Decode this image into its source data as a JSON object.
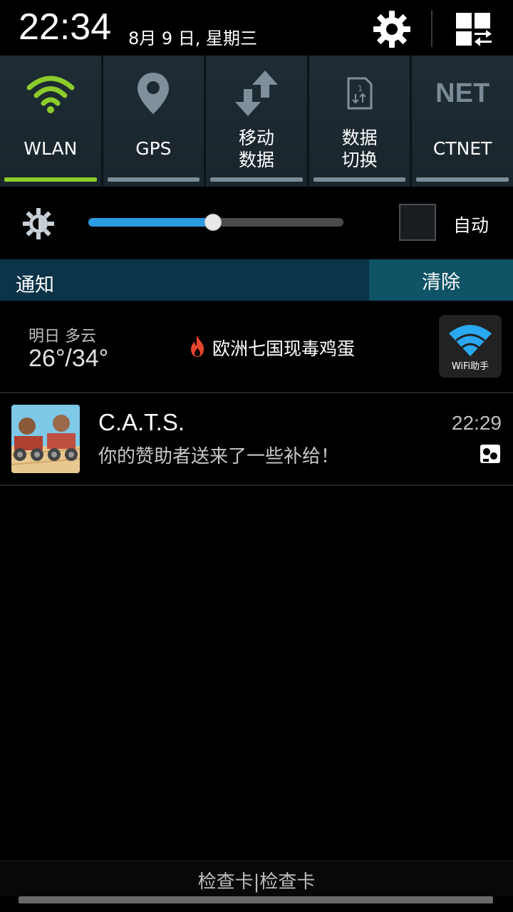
{
  "status": {
    "clock": "22:34",
    "date": "8月 9 日, 星期三"
  },
  "header": {
    "settings_icon": "gear-icon",
    "edit_icon": "grid-toggle-icon"
  },
  "toggles": [
    {
      "label": "WLAN",
      "icon": "wifi-icon",
      "active": true
    },
    {
      "label": "GPS",
      "icon": "location-pin-icon",
      "active": false
    },
    {
      "label": "移动\n数据",
      "icon": "data-arrows-icon",
      "active": false
    },
    {
      "label": "数据\n切换",
      "icon": "sim-switch-icon",
      "active": false
    },
    {
      "label": "CTNET",
      "icon": "net-icon",
      "icon_text": "NET",
      "active": false
    }
  ],
  "brightness": {
    "level": 0.49,
    "auto_label": "自动",
    "auto_checked": false
  },
  "notifications_header": {
    "title": "通知",
    "clear_label": "清除"
  },
  "weather_notification": {
    "label": "明日 多云",
    "temperature": "26°/34°",
    "headline": "欧洲七国现毒鸡蛋",
    "app_label": "WiFi助手"
  },
  "cats_notification": {
    "title": "C.A.T.S.",
    "message": "你的赞助者送来了一些补给！",
    "time": "22:29"
  },
  "footer": {
    "carrier": "检查卡|检查卡"
  },
  "colors": {
    "accent_green": "#8ccc2a",
    "slider_blue": "#2a9be0",
    "notif_header_bg": "#0c3448",
    "clear_bg": "#0f5366"
  }
}
